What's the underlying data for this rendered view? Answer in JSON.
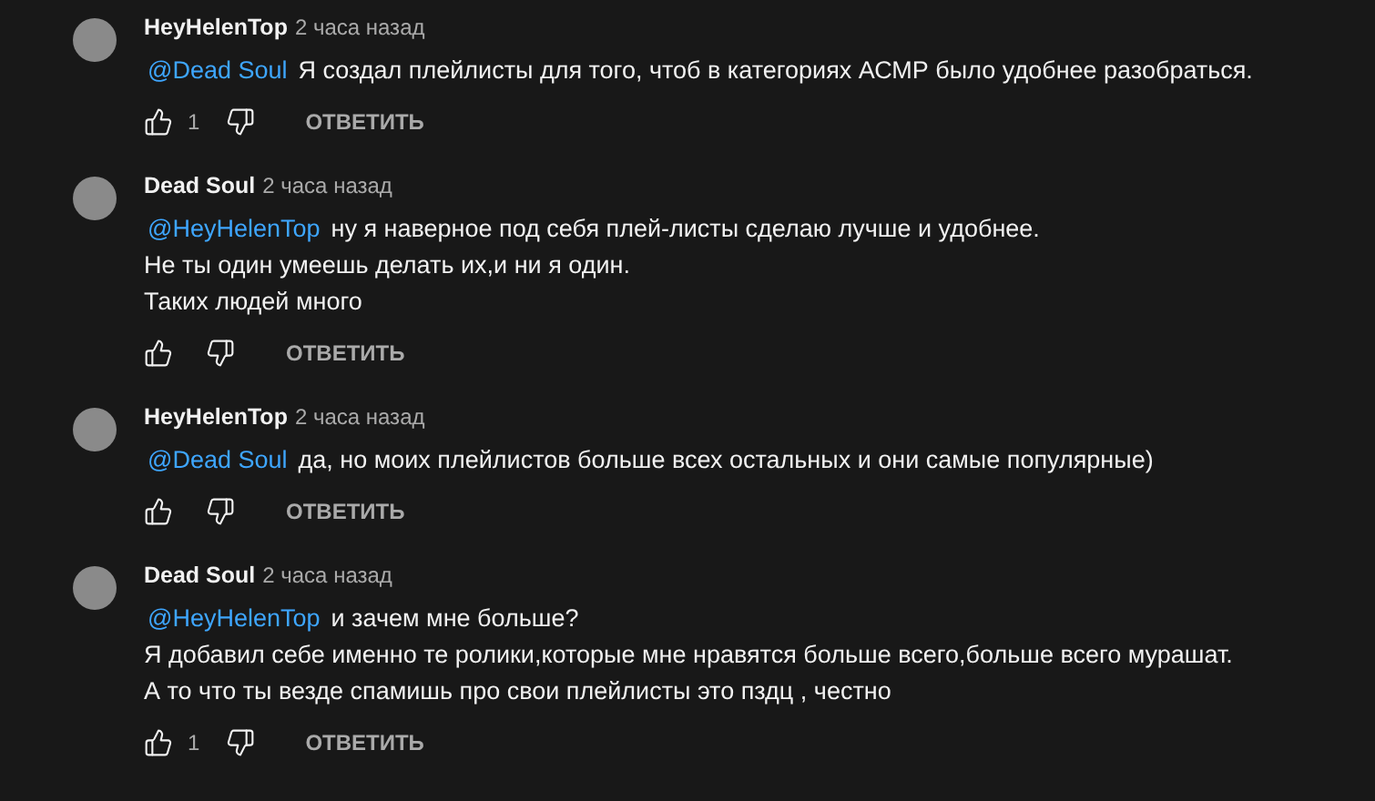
{
  "comments": [
    {
      "author": "HeyHelenTop",
      "time": "2 часа назад",
      "mention": "@Dead Soul",
      "lines": [
        "Я создал плейлисты для того, чтоб в категориях АСМР было удобнее разобраться."
      ],
      "likes": "1",
      "reply": "ОТВЕТИТЬ"
    },
    {
      "author": "Dead Soul",
      "time": "2 часа назад",
      "mention": "@HeyHelenTop",
      "lines": [
        "ну я наверное под себя плей-листы сделаю лучше и удобнее.",
        "Не ты один умеешь делать их,и ни я один.",
        "Таких людей много"
      ],
      "reply": "ОТВЕТИТЬ"
    },
    {
      "author": "HeyHelenTop",
      "time": "2 часа назад",
      "mention": "@Dead Soul",
      "lines": [
        "да, но моих плейлистов больше всех остальных и они самые популярные)"
      ],
      "reply": "ОТВЕТИТЬ"
    },
    {
      "author": "Dead Soul",
      "time": "2 часа назад",
      "mention": "@HeyHelenTop",
      "lines": [
        "и зачем мне больше?",
        "Я добавил себе именно те ролики,которые мне нравятся больше всего,больше всего мурашат.",
        "А то что ты везде спамишь про свои плейлисты это пздц , честно"
      ],
      "likes": "1",
      "reply": "ОТВЕТИТЬ"
    }
  ]
}
